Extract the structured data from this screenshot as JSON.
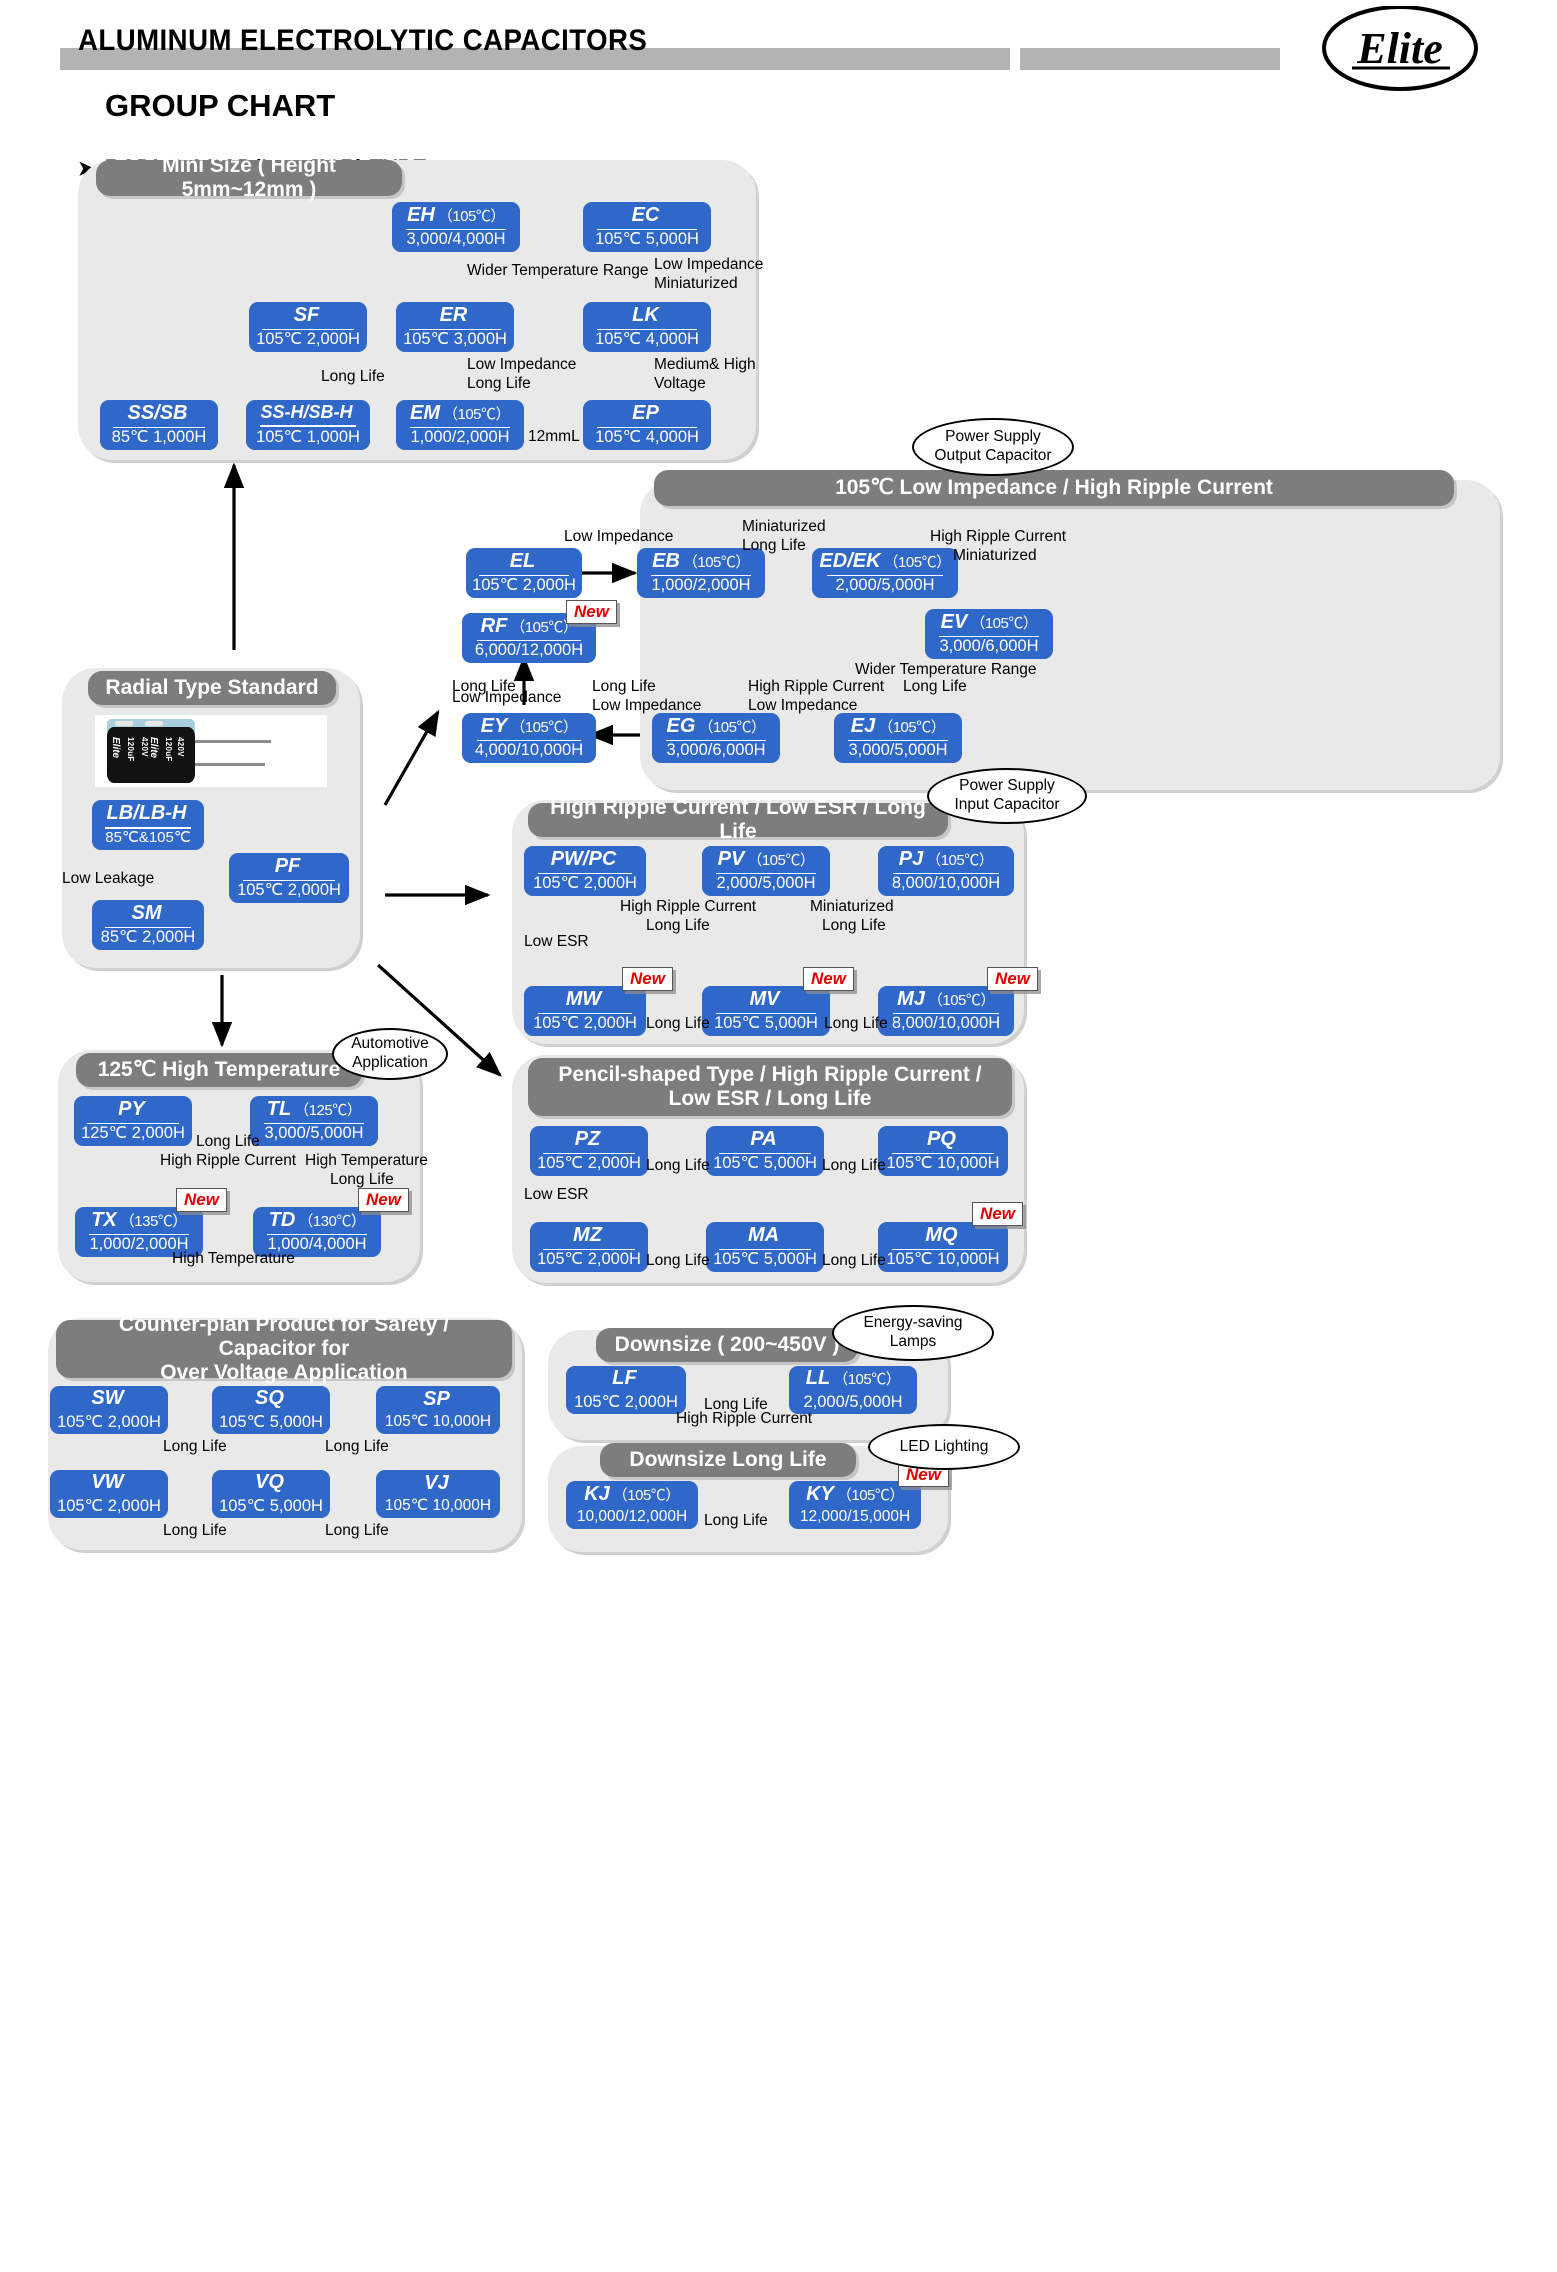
{
  "header": {
    "title": "ALUMINUM ELECTROLYTIC CAPACITORS",
    "subtitle": "GROUP CHART",
    "section": "RADIAL LEAD(Low ESR) TYPE",
    "arrow_glyph": "➤",
    "logo_text": "Elite"
  },
  "colors": {
    "box_blue": "#2f68c8",
    "panel_gray": "#e9e9e9",
    "title_gray": "#7d7d7d",
    "new_red": "#e10000",
    "header_bar": "#b3b3b3"
  },
  "badges": {
    "new": "New"
  },
  "callouts": [
    {
      "id": "power-output",
      "lines": [
        "Power Supply",
        "Output Capacitor"
      ]
    },
    {
      "id": "power-input",
      "lines": [
        "Power Supply",
        "Input Capacitor"
      ]
    },
    {
      "id": "automotive",
      "lines": [
        "Automotive",
        "Application"
      ]
    },
    {
      "id": "energy-saving",
      "lines": [
        "Energy-saving",
        "Lamps"
      ]
    },
    {
      "id": "led-lighting",
      "lines": [
        "LED Lighting"
      ]
    }
  ],
  "groups": [
    {
      "id": "mini-size",
      "title": "Mini Size ( Height 5mm~12mm )",
      "boxes": [
        {
          "id": "EH",
          "code": "EH",
          "temp": "（105℃）",
          "life": "3,000/4,000H"
        },
        {
          "id": "EC",
          "code": "EC",
          "temp": "",
          "life": "105℃ 5,000H"
        },
        {
          "id": "SF",
          "code": "SF",
          "temp": "",
          "life": "105℃ 2,000H"
        },
        {
          "id": "ER",
          "code": "ER",
          "temp": "",
          "life": "105℃ 3,000H"
        },
        {
          "id": "LK",
          "code": "LK",
          "temp": "",
          "life": "105℃ 4,000H"
        },
        {
          "id": "SSSB",
          "code": "SS/SB",
          "temp": "",
          "life": "85℃ 1,000H"
        },
        {
          "id": "SSHSBH",
          "code": "SS-H/SB-H",
          "temp": "",
          "life": "105℃ 1,000H"
        },
        {
          "id": "EM",
          "code": "EM",
          "temp": "（105℃）",
          "life": "1,000/2,000H"
        },
        {
          "id": "EP",
          "code": "EP",
          "temp": "",
          "life": "105℃ 4,000H"
        }
      ],
      "labels": [
        "Wider Temperature Range",
        "Low Impedance",
        "Miniaturized",
        "Long Life",
        "Low Impedance",
        "Long Life",
        "Medium& High",
        "Voltage",
        "12mmL"
      ]
    },
    {
      "id": "low-impedance-105",
      "title": "105℃ Low Impedance / High Ripple Current",
      "boxes": [
        {
          "id": "EL",
          "code": "EL",
          "temp": "",
          "life": "105℃ 2,000H"
        },
        {
          "id": "EB",
          "code": "EB",
          "temp": "（105℃）",
          "life": "1,000/2,000H"
        },
        {
          "id": "EDEK",
          "code": "ED/EK",
          "temp": "（105℃）",
          "life": "2,000/5,000H"
        },
        {
          "id": "EV",
          "code": "EV",
          "temp": "（105℃）",
          "life": "3,000/6,000H"
        },
        {
          "id": "RF",
          "code": "RF",
          "temp": "（105℃）",
          "life": "6,000/12,000H",
          "new": true
        },
        {
          "id": "EY",
          "code": "EY",
          "temp": "（105℃）",
          "life": "4,000/10,000H"
        },
        {
          "id": "EG",
          "code": "EG",
          "temp": "（105℃）",
          "life": "3,000/6,000H"
        },
        {
          "id": "EJ",
          "code": "EJ",
          "temp": "（105℃）",
          "life": "3,000/5,000H"
        }
      ],
      "labels": [
        "Low Impedance",
        "Miniaturized",
        "Long Life",
        "High Ripple Current",
        "Miniaturized",
        "Long Life",
        "Low Impedance",
        "Long Life",
        "Low Impedance",
        "High Ripple Current",
        "Low Impedance",
        "Wider Temperature Range",
        "Long Life"
      ]
    },
    {
      "id": "radial-standard",
      "title": "Radial Type Standard",
      "boxes": [
        {
          "id": "LBLBH",
          "code": "LB/LB-H",
          "temp": "",
          "life": "85℃&105℃"
        },
        {
          "id": "PF",
          "code": "PF",
          "temp": "",
          "life": "105℃ 2,000H"
        },
        {
          "id": "SM",
          "code": "SM",
          "temp": "",
          "life": "85℃ 2,000H"
        }
      ],
      "labels": [
        "Low Leakage"
      ],
      "photo": {
        "brand": "Elite",
        "cap": "120uF",
        "volt": "420V"
      }
    },
    {
      "id": "high-ripple-low-esr",
      "title": "High Ripple Current / Low ESR / Long Life",
      "boxes": [
        {
          "id": "PWPC",
          "code": "PW/PC",
          "temp": "",
          "life": "105℃ 2,000H"
        },
        {
          "id": "PV",
          "code": "PV",
          "temp": "（105℃）",
          "life": "2,000/5,000H"
        },
        {
          "id": "PJ",
          "code": "PJ",
          "temp": "（105℃）",
          "life": "8,000/10,000H"
        },
        {
          "id": "MW",
          "code": "MW",
          "temp": "",
          "life": "105℃ 2,000H",
          "new": true
        },
        {
          "id": "MV",
          "code": "MV",
          "temp": "",
          "life": "105℃ 5,000H",
          "new": true
        },
        {
          "id": "MJ",
          "code": "MJ",
          "temp": "（105℃）",
          "life": "8,000/10,000H",
          "new": true
        }
      ],
      "labels": [
        "High Ripple Current",
        "Long Life",
        "Miniaturized",
        "Long Life",
        "Low ESR",
        "Long Life",
        "Long Life"
      ]
    },
    {
      "id": "high-temp-125",
      "title": "125℃ High Temperature",
      "boxes": [
        {
          "id": "PY",
          "code": "PY",
          "temp": "",
          "life": "125℃ 2,000H"
        },
        {
          "id": "TL",
          "code": "TL",
          "temp": "（125℃）",
          "life": "3,000/5,000H"
        },
        {
          "id": "TX",
          "code": "TX",
          "temp": "（135℃）",
          "life": "1,000/2,000H",
          "new": true
        },
        {
          "id": "TD",
          "code": "TD",
          "temp": "（130℃）",
          "life": "1,000/4,000H",
          "new": true
        }
      ],
      "labels": [
        "Long Life",
        "High Ripple Current",
        "High Temperature",
        "Long Life",
        "High Temperature"
      ]
    },
    {
      "id": "pencil-shaped",
      "title": "Pencil-shaped Type / High Ripple Current / Low ESR / Long Life",
      "title_lines": [
        "Pencil-shaped Type / High Ripple Current /",
        "Low ESR / Long Life"
      ],
      "boxes": [
        {
          "id": "PZ",
          "code": "PZ",
          "temp": "",
          "life": "105℃ 2,000H"
        },
        {
          "id": "PA",
          "code": "PA",
          "temp": "",
          "life": "105℃ 5,000H"
        },
        {
          "id": "PQ",
          "code": "PQ",
          "temp": "",
          "life": "105℃ 10,000H"
        },
        {
          "id": "MZ",
          "code": "MZ",
          "temp": "",
          "life": "105℃ 2,000H"
        },
        {
          "id": "MA",
          "code": "MA",
          "temp": "",
          "life": "105℃ 5,000H"
        },
        {
          "id": "MQ",
          "code": "MQ",
          "temp": "",
          "life": "105℃ 10,000H",
          "new": true
        }
      ],
      "labels": [
        "Long Life",
        "Long Life",
        "Low ESR",
        "Long Life",
        "Long Life"
      ]
    },
    {
      "id": "counter-plan",
      "title": "Counter-plan Product for Safety / Capacitor for Over Voltage Application",
      "title_lines": [
        "Counter-plan Product for Safety / Capacitor for",
        "Over Voltage Application"
      ],
      "boxes": [
        {
          "id": "SW",
          "code": "SW",
          "temp": "",
          "life": "105℃ 2,000H"
        },
        {
          "id": "SQ",
          "code": "SQ",
          "temp": "",
          "life": "105℃ 5,000H"
        },
        {
          "id": "SP",
          "code": "SP",
          "temp": "",
          "life": "105℃ 10,000H"
        },
        {
          "id": "VW",
          "code": "VW",
          "temp": "",
          "life": "105℃ 2,000H"
        },
        {
          "id": "VQ",
          "code": "VQ",
          "temp": "",
          "life": "105℃ 5,000H"
        },
        {
          "id": "VJ",
          "code": "VJ",
          "temp": "",
          "life": "105℃ 10,000H"
        }
      ],
      "labels": [
        "Long Life",
        "Long Life",
        "Long Life",
        "Long Life"
      ]
    },
    {
      "id": "downsize",
      "title": "Downsize ( 200~450V )",
      "boxes": [
        {
          "id": "LF",
          "code": "LF",
          "temp": "",
          "life": "105℃ 2,000H"
        },
        {
          "id": "LL",
          "code": "LL",
          "temp": "（105℃）",
          "life": "2,000/5,000H"
        }
      ],
      "labels": [
        "Long Life",
        "High Ripple Current"
      ]
    },
    {
      "id": "downsize-long-life",
      "title": "Downsize Long Life",
      "boxes": [
        {
          "id": "KJ",
          "code": "KJ",
          "temp": "（105℃）",
          "life": "10,000/12,000H"
        },
        {
          "id": "KY",
          "code": "KY",
          "temp": "（105℃）",
          "life": "12,000/15,000H",
          "new": true
        }
      ],
      "labels": [
        "Long Life"
      ]
    }
  ]
}
